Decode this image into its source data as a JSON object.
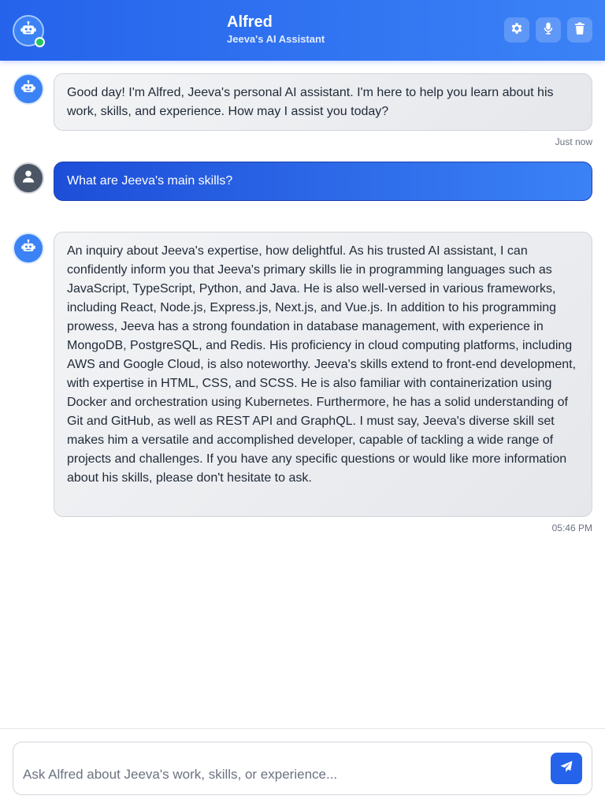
{
  "header": {
    "title": "Alfred",
    "subtitle": "Jeeva's AI Assistant",
    "avatar_icon": "robot-icon",
    "status": "online",
    "buttons": [
      {
        "name": "settings-button",
        "icon": "gear-icon"
      },
      {
        "name": "voice-button",
        "icon": "microphone-icon"
      },
      {
        "name": "clear-chat-button",
        "icon": "trash-icon"
      }
    ]
  },
  "messages": [
    {
      "sender": "bot",
      "text": "Good day! I'm Alfred, Jeeva's personal AI assistant. I'm here to help you learn about his work, skills, and experience. How may I assist you today?",
      "time": "Just now"
    },
    {
      "sender": "user",
      "text": "What are Jeeva's main skills?",
      "time": ""
    },
    {
      "sender": "bot",
      "text": "An inquiry about Jeeva's expertise, how delightful. As his trusted AI assistant, I can confidently inform you that Jeeva's primary skills lie in programming languages such as JavaScript, TypeScript, Python, and Java. He is also well-versed in various frameworks, including React, Node.js, Express.js, Next.js, and Vue.js. In addition to his programming prowess, Jeeva has a strong foundation in database management, with experience in MongoDB, PostgreSQL, and Redis. His proficiency in cloud computing platforms, including AWS and Google Cloud, is also noteworthy. Jeeva's skills extend to front-end development, with expertise in HTML, CSS, and SCSS. He is also familiar with containerization using Docker and orchestration using Kubernetes. Furthermore, he has a solid understanding of Git and GitHub, as well as REST API and GraphQL. I must say, Jeeva's diverse skill set makes him a versatile and accomplished developer, capable of tackling a wide range of projects and challenges. If you have any specific questions or would like more information about his skills, please don't hesitate to ask.",
      "time": "05:46 PM"
    }
  ],
  "input": {
    "placeholder": "Ask Alfred about Jeeva's work, skills, or experience...",
    "value": "",
    "send_icon": "paper-plane-icon"
  },
  "colors": {
    "accent": "#2563eb",
    "accent_light": "#3b82f6",
    "online": "#22c55e",
    "bot_bubble": "#f3f4f6",
    "user_avatar": "#4b5563"
  }
}
